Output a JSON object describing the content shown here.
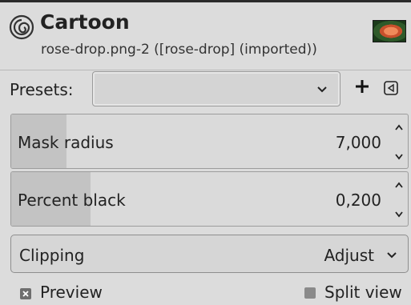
{
  "header": {
    "title": "Cartoon",
    "subtitle": "rose-drop.png-2 ([rose-drop] (imported))"
  },
  "presets": {
    "label": "Presets:",
    "value": ""
  },
  "mask_radius": {
    "label": "Mask radius",
    "value": "7,000",
    "fill_fraction": 0.14
  },
  "percent_black": {
    "label": "Percent black",
    "value": "0,200",
    "fill_fraction": 0.2
  },
  "clipping": {
    "label": "Clipping",
    "value": "Adjust"
  },
  "preview": {
    "label": "Preview",
    "checked": true
  },
  "split_view": {
    "label": "Split view",
    "checked": false
  },
  "colors": {
    "background": "#dcdcdc",
    "slider_fill": "#c3c3c3"
  }
}
